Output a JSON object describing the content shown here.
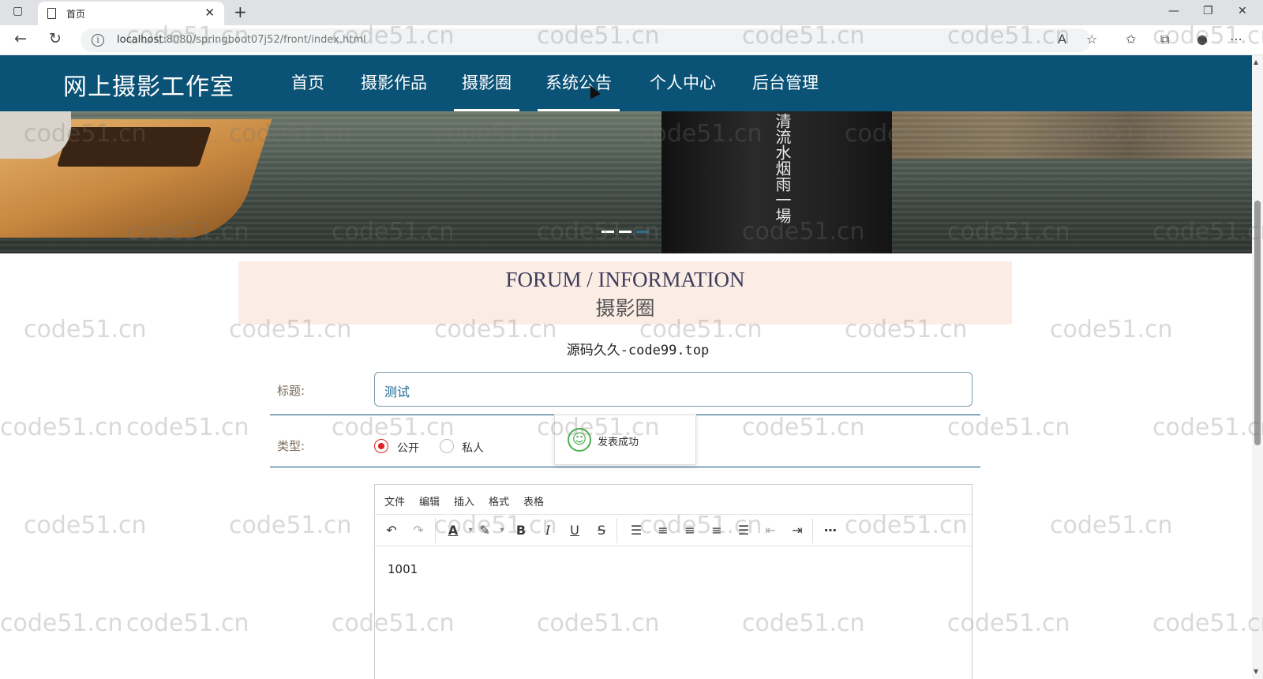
{
  "browser": {
    "tab_title": "首页",
    "url_host": "localhost",
    "url_rest": ":8080/springboot07j52/front/index.html"
  },
  "site": {
    "brand": "网上摄影工作室",
    "nav": [
      {
        "label": "首页"
      },
      {
        "label": "摄影作品"
      },
      {
        "label": "摄影圈"
      },
      {
        "label": "系统公告"
      },
      {
        "label": "个人中心"
      },
      {
        "label": "后台管理"
      }
    ]
  },
  "banner": {
    "poem": "清流水烟雨一場"
  },
  "section": {
    "title_en": "FORUM / INFORMATION",
    "title_cn": "摄影圈",
    "source_note": "源码久久-code99.top"
  },
  "form": {
    "title_label": "标题:",
    "title_value": "测试",
    "type_label": "类型:",
    "type_options": [
      {
        "label": "公开",
        "checked": true
      },
      {
        "label": "私人",
        "checked": false
      }
    ]
  },
  "toast": {
    "message": "发表成功"
  },
  "editor": {
    "menus": [
      "文件",
      "编辑",
      "插入",
      "格式",
      "表格"
    ],
    "content": "1001"
  },
  "watermark": "code51.cn",
  "colors": {
    "header_bg": "#0a5276",
    "section_bg": "#fbece4",
    "radio_active": "#dd2222"
  }
}
